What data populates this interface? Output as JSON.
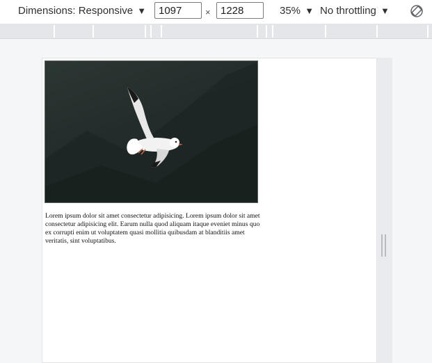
{
  "toolbar": {
    "dimensions_label": "Dimensions: Responsive",
    "dropdown_arrow": "▼",
    "width_value": "1097",
    "height_value": "1228",
    "times_symbol": "×",
    "zoom_label": "35%",
    "throttling_label": "No throttling",
    "rotate_icon": "rotate-icon"
  },
  "viewport": {
    "image": "seagull-in-flight-photo",
    "paragraph": "Lorem ipsum dolor sit amet consectetur adipisicing. Lorem ipsum dolor sit amet consectetur adipisicing elit. Earum nulla quod aliquam itaque eveniet minus quo ex corrupti enim ut voluptatem quasi mollitia quibusdam at blanditiis amet veritatis, sint voluptatibus."
  }
}
